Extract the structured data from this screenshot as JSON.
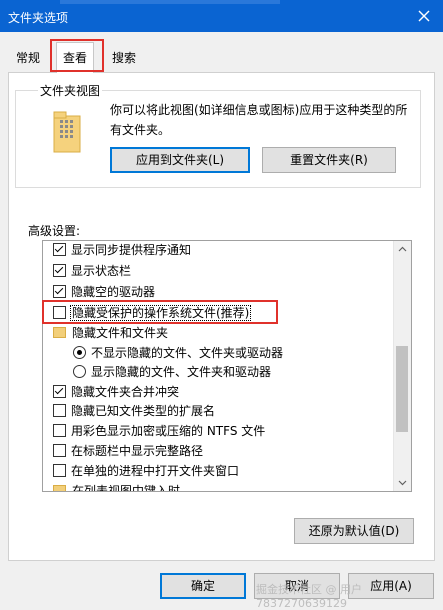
{
  "window": {
    "title": "文件夹选项"
  },
  "tabs": [
    {
      "label": "常规"
    },
    {
      "label": "查看"
    },
    {
      "label": "搜索"
    }
  ],
  "folder_views": {
    "title": "文件夹视图",
    "description": "你可以将此视图(如详细信息或图标)应用于这种类型的所有文件夹。",
    "apply_button": "应用到文件夹(L)",
    "reset_button": "重置文件夹(R)"
  },
  "advanced": {
    "label": "高级设置:",
    "items": [
      {
        "type": "checkbox",
        "checked": true,
        "label": "显示同步提供程序通知"
      },
      {
        "type": "checkbox",
        "checked": true,
        "label": "显示状态栏"
      },
      {
        "type": "checkbox",
        "checked": true,
        "label": "隐藏空的驱动器"
      },
      {
        "type": "checkbox",
        "checked": false,
        "label": "隐藏受保护的操作系统文件(推荐)"
      },
      {
        "type": "folder",
        "label": "隐藏文件和文件夹"
      },
      {
        "type": "radio",
        "checked": true,
        "label": "不显示隐藏的文件、文件夹或驱动器"
      },
      {
        "type": "radio",
        "checked": false,
        "label": "显示隐藏的文件、文件夹和驱动器"
      },
      {
        "type": "checkbox",
        "checked": true,
        "label": "隐藏文件夹合并冲突"
      },
      {
        "type": "checkbox",
        "checked": false,
        "label": "隐藏已知文件类型的扩展名"
      },
      {
        "type": "checkbox",
        "checked": false,
        "label": "用彩色显示加密或压缩的 NTFS 文件"
      },
      {
        "type": "checkbox",
        "checked": false,
        "label": "在标题栏中显示完整路径"
      },
      {
        "type": "checkbox",
        "checked": false,
        "label": "在单独的进程中打开文件夹窗口"
      },
      {
        "type": "folder",
        "label": "在列表视图中键入时"
      }
    ],
    "restore_button": "还原为默认值(D)"
  },
  "footer": {
    "ok_button": "确定",
    "cancel_button": "取消",
    "apply_button": "应用(A)"
  },
  "watermark": "掘金技术社区 @ 用户7837270639129",
  "colors": {
    "titlebar": "#0a64d2",
    "highlight": "#e0312b",
    "panel": "#ffffff",
    "window_bg": "#f0f0f0"
  }
}
